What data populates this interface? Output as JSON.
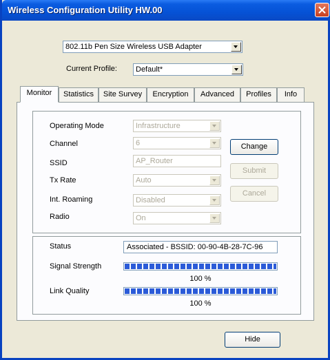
{
  "window": {
    "title": "Wireless Configuration Utility HW.00"
  },
  "adapter": {
    "selected": "802.11b Pen Size Wireless USB Adapter"
  },
  "profile": {
    "label": "Current Profile:",
    "selected": "Default*"
  },
  "tabs": [
    {
      "label": "Monitor",
      "active": true
    },
    {
      "label": "Statistics"
    },
    {
      "label": "Site Survey"
    },
    {
      "label": "Encryption"
    },
    {
      "label": "Advanced"
    },
    {
      "label": "Profiles"
    },
    {
      "label": "Info"
    }
  ],
  "settings": {
    "operating_mode": {
      "label": "Operating Mode",
      "value": "Infrastructure"
    },
    "channel": {
      "label": "Channel",
      "value": "6"
    },
    "ssid": {
      "label": "SSID",
      "value": "AP_Router"
    },
    "tx_rate": {
      "label": "Tx Rate",
      "value": "Auto"
    },
    "int_roaming": {
      "label": "Int. Roaming",
      "value": "Disabled"
    },
    "radio": {
      "label": "Radio",
      "value": "On"
    }
  },
  "buttons": {
    "change": "Change",
    "submit": "Submit",
    "cancel": "Cancel",
    "hide": "Hide"
  },
  "status": {
    "label": "Status",
    "value": "Associated - BSSID: 00-90-4B-28-7C-96",
    "signal_label": "Signal Strength",
    "signal_percent": "100 %",
    "signal_level": 1.0,
    "quality_label": "Link Quality",
    "quality_percent": "100 %",
    "quality_level": 1.0
  },
  "colors": {
    "titlebar": "#0552D6",
    "bar_fill": "#2B5BD8",
    "close": "#C8401F"
  },
  "icons": {
    "close": "close-icon",
    "dropdown": "chevron-down-icon"
  }
}
